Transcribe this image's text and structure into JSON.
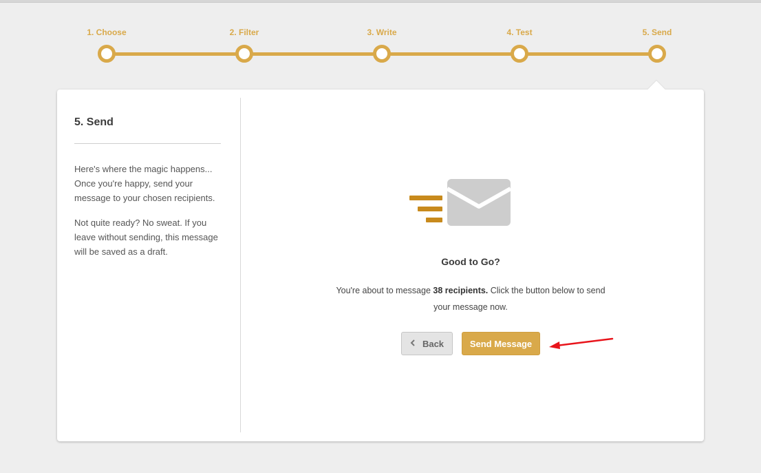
{
  "steps": [
    {
      "label": "1. Choose"
    },
    {
      "label": "2. Filter"
    },
    {
      "label": "3. Write"
    },
    {
      "label": "4. Test"
    },
    {
      "label": "5. Send"
    }
  ],
  "sidebar": {
    "title": "5. Send",
    "paragraph1": "Here's where the magic happens... Once you're happy, send your message to your chosen recipients.",
    "paragraph2": "Not quite ready? No sweat. If you leave without sending, this message will be saved as a draft."
  },
  "main": {
    "icon": "envelope-send-icon",
    "headline": "Good to Go?",
    "description_prefix": "You're about to message ",
    "recipients": "38 recipients.",
    "description_suffix": " Click the button below to send your message now.",
    "back_label": "Back",
    "send_label": "Send Message"
  },
  "colors": {
    "accent": "#d9a94a",
    "icon_accent": "#c88a1c",
    "annotation_arrow": "#e8141b",
    "background": "#eeeeee"
  }
}
